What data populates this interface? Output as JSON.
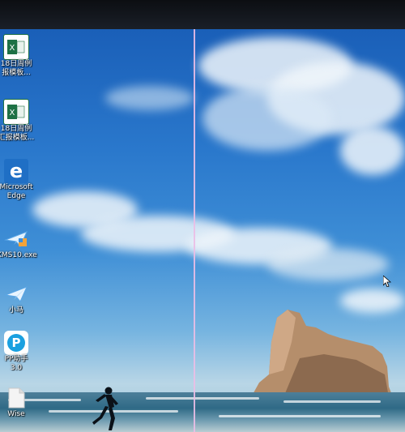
{
  "desktop": {
    "icons": [
      {
        "name": "excel-file-1",
        "icon": "excel-icon",
        "line1": "18日周例",
        "line2": "报模板..."
      },
      {
        "name": "excel-file-2",
        "icon": "excel-icon",
        "line1": "18日周例",
        "line2": "汇报模板..."
      },
      {
        "name": "microsoft-edge",
        "icon": "edge-icon",
        "line1": "Microsoft",
        "line2": "Edge"
      },
      {
        "name": "kms10",
        "icon": "kms-icon",
        "line1": "KMS10.exe",
        "line2": ""
      },
      {
        "name": "xiaoma",
        "icon": "kms-icon",
        "line1": "小马",
        "line2": ""
      },
      {
        "name": "pp-assistant",
        "icon": "pp-icon",
        "line1": "PP助手",
        "line2": "3.0"
      },
      {
        "name": "file-item",
        "icon": "file-icon",
        "line1": "Wise",
        "line2": ""
      }
    ]
  },
  "colors": {
    "excel": "#1e7145",
    "edge": "#1f6fc5",
    "pp": "#1aa0e0"
  }
}
